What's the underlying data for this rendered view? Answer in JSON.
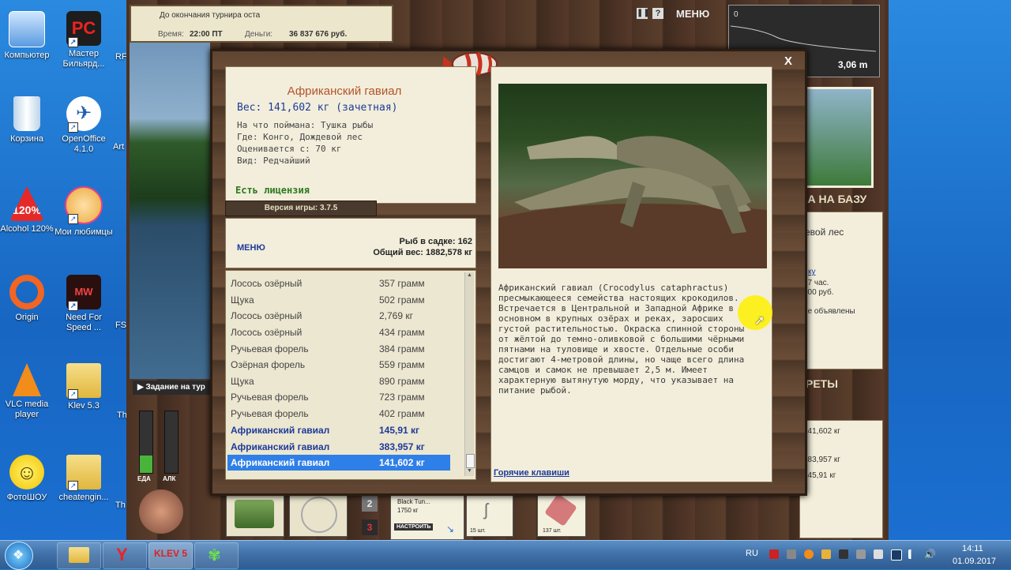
{
  "desktop_icons": [
    {
      "label": "Компьютер",
      "icon": "computer-icon"
    },
    {
      "label": "Мастер Бильярд...",
      "icon": "billiard-icon"
    },
    {
      "label": "Корзина",
      "icon": "recycle-bin-icon"
    },
    {
      "label": "OpenOffice 4.1.0",
      "icon": "openoffice-icon"
    },
    {
      "label": "Alcohol 120%",
      "icon": "alcohol-icon"
    },
    {
      "label": "Мои любимцы",
      "icon": "pet-icon"
    },
    {
      "label": "Origin",
      "icon": "origin-icon"
    },
    {
      "label": "Need For Speed ...",
      "icon": "nfs-icon"
    },
    {
      "label": "VLC media player",
      "icon": "vlc-icon"
    },
    {
      "label": "Klev 5.3",
      "icon": "folder-icon"
    },
    {
      "label": "ФотоШОУ",
      "icon": "smiley-icon"
    },
    {
      "label": "cheatengin...",
      "icon": "folder-icon"
    }
  ],
  "desktop_partial_labels": [
    "RF",
    "Art",
    "FS",
    "Th",
    "Th"
  ],
  "game": {
    "tournament_text": "До окончания турнира оста",
    "time_label": "Время:",
    "time_value": "22:00 ПТ",
    "money_label": "Деньги:",
    "money_value": "36 837 676 руб.",
    "menu_top": "МЕНЮ",
    "depth_value": "3,06 m",
    "depth_zero": "0",
    "right_panel_header": "КА НА БАЗУ",
    "right_panel_location": "евой лес",
    "right_panel_lines": [
      "ку",
      "17 час.",
      "000 руб.",
      "ие объявлены"
    ],
    "right_panel_header2": "РЕТЫ",
    "right_panel_records": [
      "141,602 кг",
      "383,957 кг",
      "145,91 кг"
    ],
    "task_text": "Задание на тур",
    "food_label": "ЕДА",
    "alc_label": "АЛК",
    "slot_2": "2",
    "slot_3": "3",
    "bait_name": "Black Tun...",
    "bait_weight": "1750 кг",
    "setup_button": "НАСТРОИТЬ",
    "bait_count_1": "15 шт.",
    "bait_count_2": "137 шт."
  },
  "modal": {
    "close": "X",
    "fish_title": "Африканский гавиал",
    "weight_line": "Вес: 141,602 кг (зачетная)",
    "caught_on": "На что поймана: Тушка рыбы",
    "where": "Где: Конго, Дождевой лес",
    "value": "Оценивается с: 70 кг",
    "rarity": "Вид: Редчайший",
    "license": "Есть лицензия",
    "version": "Версия игры: 3.7.5",
    "menu_label": "МЕНЮ",
    "fish_in_cage": "Рыб в садке: 162",
    "total_weight": "Общий вес: 1882,578 кг",
    "description": "Африканский гавиал (Crocodylus cataphractus) пресмыкающееся семейства настоящих крокодилов. Встречается в Центральной и Западной Африке в основном в крупных озёрах и реках, заросших густой растительностью. Окраска спинной стороны от жёлтой до темно-оливковой с большими чёрными пятнами на туловище и хвосте. Отдельные особи достигают 4-метровой длины, но чаще всего длина самцов и самок не превышает 2,5 м. Имеет характерную вытянутую морду, что указывает на питание рыбой.",
    "hotkeys": "Горячие клавиши",
    "catch_list": [
      {
        "name": "Лосось озёрный",
        "weight": "357 грамм",
        "state": "normal"
      },
      {
        "name": "Щука",
        "weight": "502 грамм",
        "state": "normal"
      },
      {
        "name": "Лосось озёрный",
        "weight": "2,769 кг",
        "state": "normal"
      },
      {
        "name": "Лосось озёрный",
        "weight": "434 грамм",
        "state": "normal"
      },
      {
        "name": "Ручьевая форель",
        "weight": "384 грамм",
        "state": "normal"
      },
      {
        "name": "Озёрная форель",
        "weight": "559 грамм",
        "state": "normal"
      },
      {
        "name": "Щука",
        "weight": "890 грамм",
        "state": "normal"
      },
      {
        "name": "Ручьевая форель",
        "weight": "723 грамм",
        "state": "normal"
      },
      {
        "name": "Ручьевая форель",
        "weight": "402 грамм",
        "state": "normal"
      },
      {
        "name": "Африканский гавиал",
        "weight": "145,91 кг",
        "state": "highlight"
      },
      {
        "name": "Африканский гавиал",
        "weight": "383,957 кг",
        "state": "highlight"
      },
      {
        "name": "Африканский гавиал",
        "weight": "141,602 кг",
        "state": "selected"
      }
    ]
  },
  "taskbar": {
    "app_4_label": "KLEV 5",
    "lang": "RU",
    "time": "14:11",
    "date": "01.09.2017"
  },
  "colors": {
    "accent": "#2f7fe8",
    "title_orange": "#b4532a",
    "highlight_blue": "#1e3a9a",
    "license_green": "#2d7a1f"
  }
}
